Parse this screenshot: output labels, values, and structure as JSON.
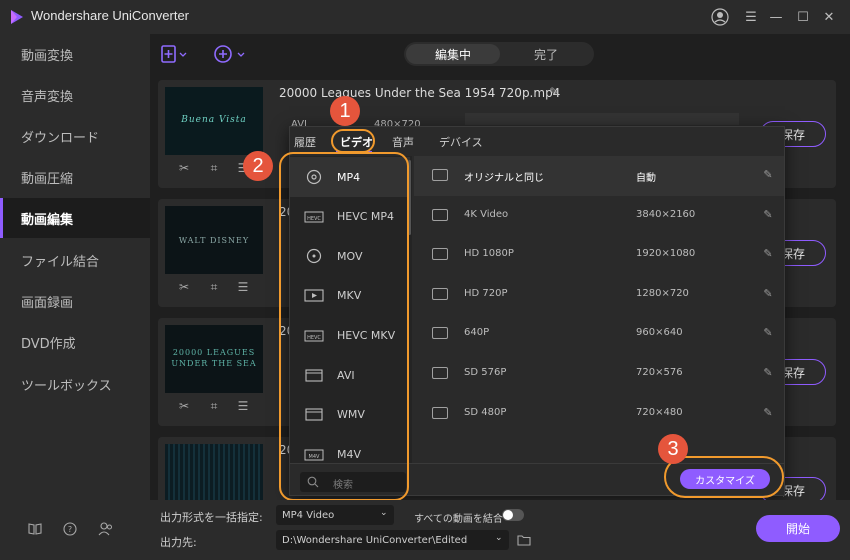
{
  "app": {
    "title": "Wondershare UniConverter"
  },
  "colors": {
    "accent": "#8f5cff",
    "annotation": "#e5553c",
    "highlight": "#f19a2d"
  },
  "sidebar": {
    "items": [
      {
        "label": "動画変換"
      },
      {
        "label": "音声変換"
      },
      {
        "label": "ダウンロード"
      },
      {
        "label": "動画圧縮"
      },
      {
        "label": "動画編集"
      },
      {
        "label": "ファイル結合"
      },
      {
        "label": "画面録画"
      },
      {
        "label": "DVD作成"
      },
      {
        "label": "ツールボックス"
      }
    ],
    "active_index": 4,
    "footer_icons": [
      "book-icon",
      "help-icon",
      "account-icon"
    ]
  },
  "header": {
    "tabs": [
      {
        "label": "編集中"
      },
      {
        "label": "完了"
      }
    ],
    "add_file_icon": "add-file-icon",
    "add_dvd_icon": "add-dvd-icon"
  },
  "files": [
    {
      "name": "20000 Leagues Under the Sea 1954 720p.mp4",
      "format_label": "AVI",
      "resolution": "480×720",
      "thumb_text": "Buena Vista",
      "save_label": "保存"
    },
    {
      "name": "20",
      "thumb_text": "WALT DISNEY",
      "save_label": "保存"
    },
    {
      "name": "20",
      "thumb_text": "20000 LEAGUES UNDER THE SEA",
      "save_label": "保存"
    },
    {
      "name": "20",
      "thumb_text": "",
      "save_label": "保存"
    }
  ],
  "popup": {
    "tabs": [
      {
        "label": "履歴"
      },
      {
        "label": "ビデオ"
      },
      {
        "label": "音声"
      },
      {
        "label": "デバイス"
      }
    ],
    "active_tab": 1,
    "formats": [
      {
        "label": "MP4",
        "icon": "mp4-icon"
      },
      {
        "label": "HEVC MP4",
        "icon": "hevc-icon"
      },
      {
        "label": "MOV",
        "icon": "mov-icon"
      },
      {
        "label": "MKV",
        "icon": "mkv-icon"
      },
      {
        "label": "HEVC MKV",
        "icon": "hevc-icon"
      },
      {
        "label": "AVI",
        "icon": "avi-icon"
      },
      {
        "label": "WMV",
        "icon": "wmv-icon"
      },
      {
        "label": "M4V",
        "icon": "m4v-icon"
      }
    ],
    "search_placeholder": "検索",
    "qualities": [
      {
        "name": "オリジナルと同じ",
        "res": "自動"
      },
      {
        "name": "4K Video",
        "res": "3840×2160"
      },
      {
        "name": "HD 1080P",
        "res": "1920×1080"
      },
      {
        "name": "HD 720P",
        "res": "1280×720"
      },
      {
        "name": "640P",
        "res": "960×640"
      },
      {
        "name": "SD 576P",
        "res": "720×576"
      },
      {
        "name": "SD 480P",
        "res": "720×480"
      }
    ],
    "customize_label": "カスタマイズ"
  },
  "annotations": [
    "1",
    "2",
    "3"
  ],
  "bottom": {
    "output_format_label": "出力形式を一括指定:",
    "output_format_value": "MP4 Video",
    "merge_label": "すべての動画を結合",
    "output_path_label": "出力先:",
    "output_path_value": "D:\\Wondershare UniConverter\\Edited",
    "start_label": "開始"
  }
}
